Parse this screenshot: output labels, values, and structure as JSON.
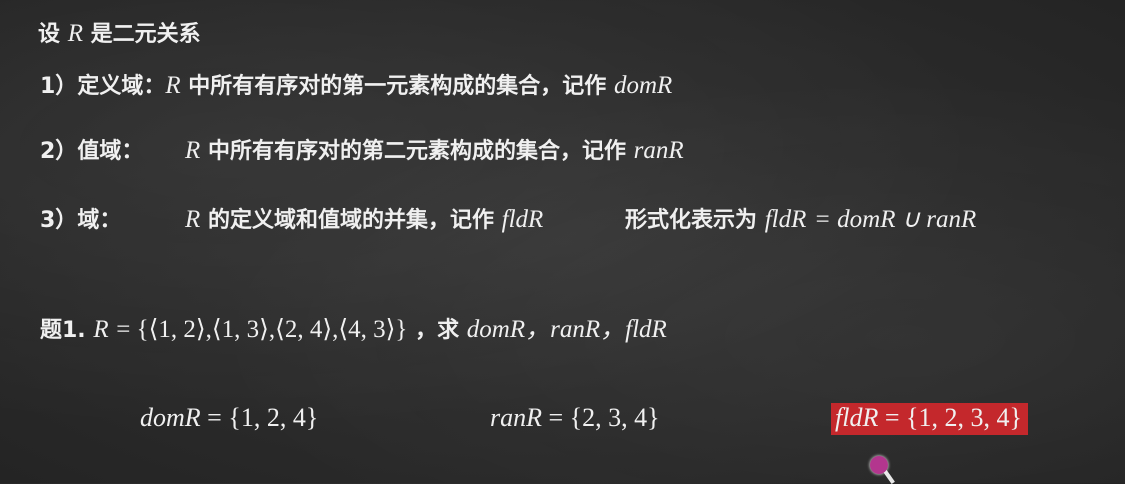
{
  "heading": {
    "prefix": "设",
    "var": "R",
    "suffix": "是二元关系"
  },
  "items": [
    {
      "number": "1）",
      "term": "定义域：",
      "var": "R",
      "text": "中所有有序对的第一元素构成的集合，记作",
      "notation": "domR"
    },
    {
      "number": "2）",
      "term": "值域：",
      "var": "R",
      "text": "中所有有序对的第二元素构成的集合，记作",
      "notation": "ranR"
    },
    {
      "number": "3）",
      "term": "域：",
      "var": "R",
      "text": "的定义域和值域的并集，记作",
      "notation": "fldR",
      "formal_label": "形式化表示为",
      "formal_lhs": "fldR",
      "formal_rhs": "= domR ∪ ranR"
    }
  ],
  "problem": {
    "label": "题1.",
    "var": "R",
    "set": "= {⟨1, 2⟩,⟨1, 3⟩,⟨2, 4⟩,⟨4, 3⟩}",
    "ask": "，求",
    "targets": "domR，ranR，fldR"
  },
  "answers": {
    "dom": {
      "lhs": "domR",
      "rhs": " = {1, 2, 4}"
    },
    "ran": {
      "lhs": "ranR",
      "rhs": " = {2, 3, 4}"
    },
    "fld": {
      "lhs": "fldR",
      "rhs": " = {1, 2, 3, 4}",
      "highlight_color": "#c4282c"
    }
  }
}
